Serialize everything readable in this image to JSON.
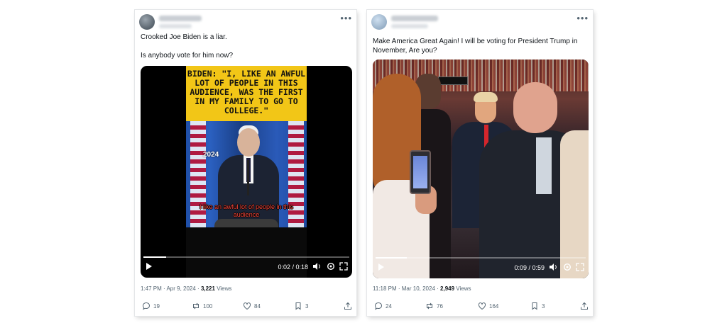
{
  "tweets": [
    {
      "text": "Crooked Joe Biden is a liar.\n\nIs anybody vote for him now?",
      "video": {
        "caption": "BIDEN: \"I, LIKE AN AWFUL LOT OF PEOPLE IN THIS AUDIENCE, WAS THE FIRST IN MY FAMILY TO GO TO COLLEGE.\"",
        "year_label": "2024",
        "subtitle": "I like an awful lot of people in this audience",
        "time": "0:02 / 0:18",
        "progress": 0.11
      },
      "time_date": "1:47 PM · Apr 9, 2024 · ",
      "views_count": "3,221",
      "views_label": " Views",
      "replies": "19",
      "retweets": "100",
      "likes": "84",
      "bookmarks": "3"
    },
    {
      "text": "Make America Great Again! I will be voting for President Trump in November, Are you?",
      "video": {
        "time": "0:09 / 0:59",
        "progress": 0.15
      },
      "time_date": "11:18 PM · Mar 10, 2024 · ",
      "views_count": "2,949",
      "views_label": " Views",
      "replies": "24",
      "retweets": "76",
      "likes": "164",
      "bookmarks": "3"
    }
  ],
  "more_icon": "more-horizontal-icon",
  "colors": {
    "text": "#0f1419",
    "muted": "#536471",
    "caption_bg": "#f2c617",
    "subtitle": "#ff4a3d"
  }
}
